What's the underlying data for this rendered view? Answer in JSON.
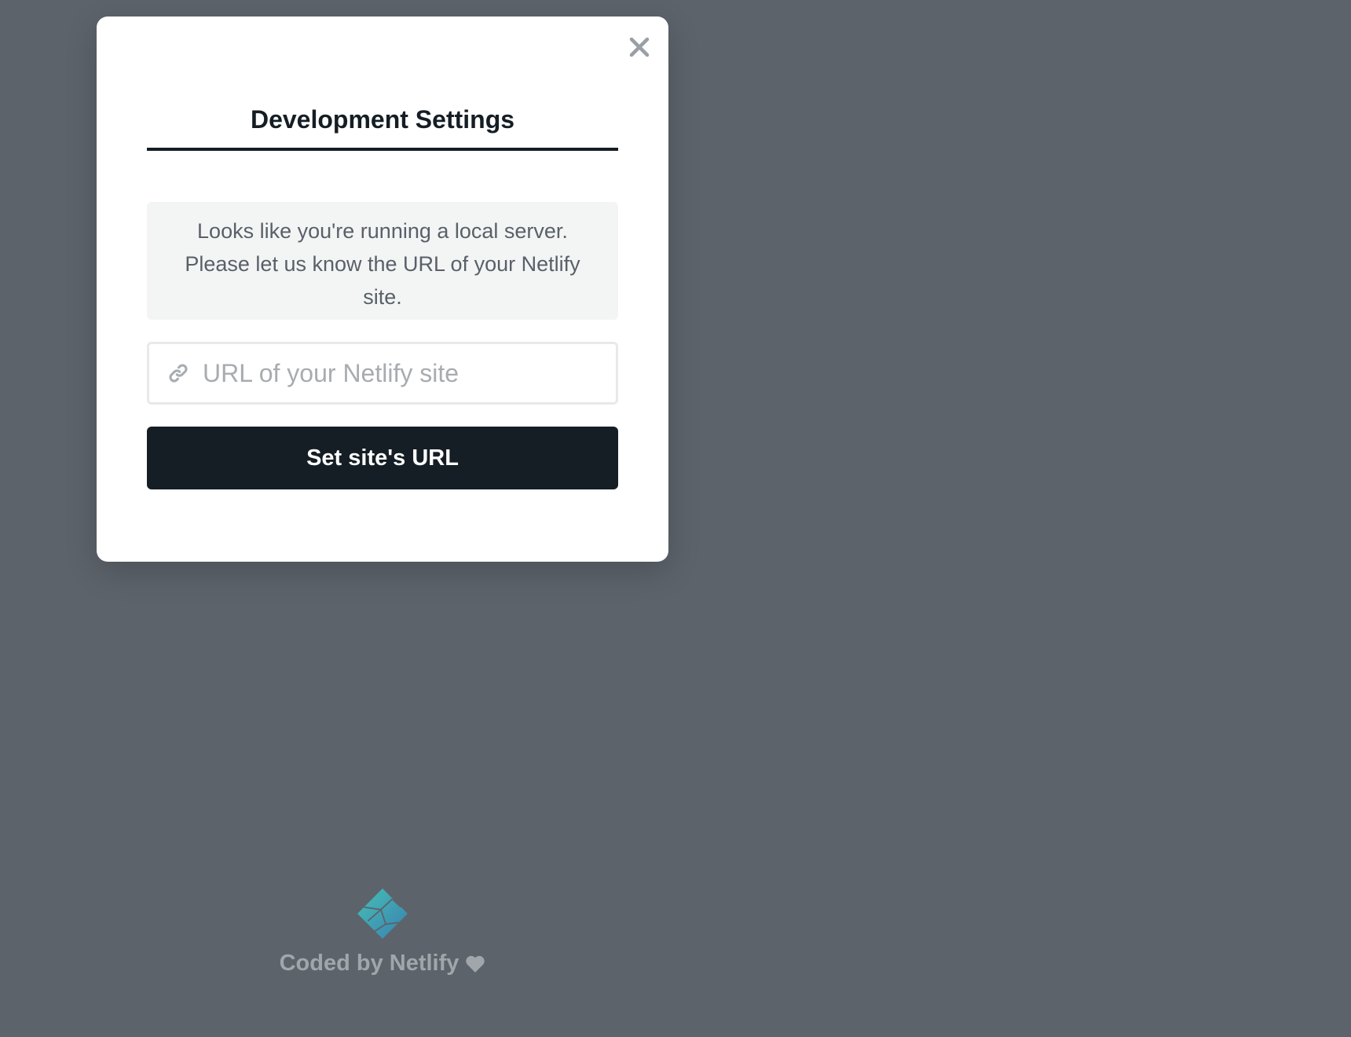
{
  "modal": {
    "title": "Development Settings",
    "notice": "Looks like you're running a local server. Please let us know the URL of your Netlify site.",
    "url_input": {
      "value": "",
      "placeholder": "URL of your Netlify site"
    },
    "submit_label": "Set site's URL",
    "close_icon": "close-icon",
    "link_icon": "link-icon"
  },
  "footer": {
    "text": "Coded by Netlify",
    "heart_icon": "heart-icon",
    "logo": "netlify-logo"
  },
  "colors": {
    "background": "#5d636b",
    "primary_dark": "#151e24",
    "notice_bg": "#f3f5f5",
    "muted_text": "#a1a6aa",
    "netlify_teal": "#3ca3ad"
  }
}
